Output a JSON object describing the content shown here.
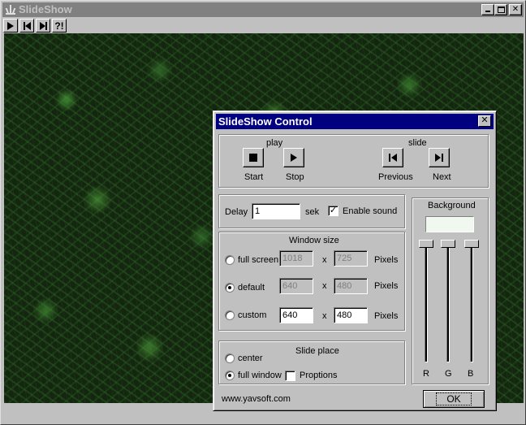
{
  "main_window": {
    "title": "SlideShow",
    "toolbar": {
      "help_label": "?!"
    }
  },
  "dialog": {
    "title": "SlideShow Control",
    "close_label": "✕",
    "play_group": {
      "play_label": "play",
      "slide_label": "slide",
      "start_label": "Start",
      "stop_label": "Stop",
      "previous_label": "Previous",
      "next_label": "Next"
    },
    "delay": {
      "label": "Delay",
      "value": "1",
      "unit": "sek",
      "enable_sound_label": "Enable sound",
      "enable_sound_checked": true
    },
    "window_size": {
      "title": "Window size",
      "x_label": "x",
      "pixels_label": "Pixels",
      "full_screen": {
        "label": "full screen",
        "width": "1018",
        "height": "725"
      },
      "default": {
        "label": "default",
        "width": "640",
        "height": "480"
      },
      "custom": {
        "label": "custom",
        "width": "640",
        "height": "480"
      },
      "selected": "default"
    },
    "slide_place": {
      "title": "Slide place",
      "center_label": "center",
      "full_window_label": "full window",
      "proptions_label": "Proptions",
      "selected": "full window"
    },
    "background": {
      "title": "Background",
      "r_label": "R",
      "g_label": "G",
      "b_label": "B",
      "color": "#f0f8f0"
    },
    "footer": {
      "website": "www.yavsoft.com",
      "ok_label": "OK"
    }
  }
}
